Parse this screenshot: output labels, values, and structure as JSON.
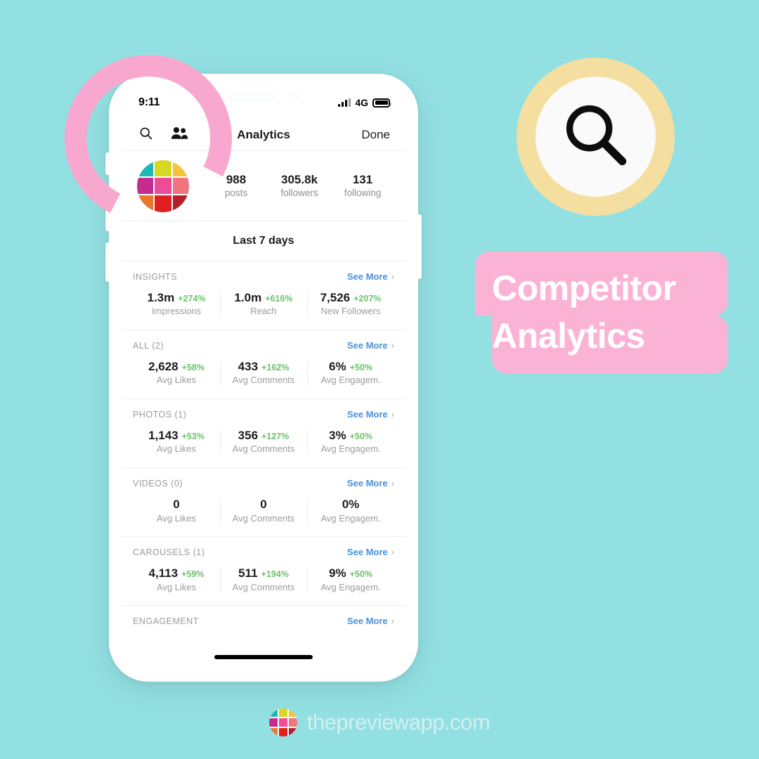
{
  "background_color": "#93e0e3",
  "status_bar": {
    "time": "9:11",
    "network": "4G",
    "signal_icon": "signal-bars-icon",
    "battery_icon": "battery-full-icon"
  },
  "nav_bar": {
    "search_icon": "search-icon",
    "people_icon": "people-icon",
    "title": "Analytics",
    "done_label": "Done"
  },
  "profile": {
    "avatar_icon": "profile-avatar-grid",
    "avatar_colors": [
      "#21b6b6",
      "#d7d824",
      "#f5c33c",
      "#c32b8e",
      "#ee4b99",
      "#f0757f",
      "#e8762b",
      "#e02020",
      "#b41f2a"
    ],
    "stats": [
      {
        "value": "988",
        "label": "posts"
      },
      {
        "value": "305.8k",
        "label": "followers"
      },
      {
        "value": "131",
        "label": "following"
      }
    ]
  },
  "period": {
    "label": "Last 7 days"
  },
  "see_more_label": "See More",
  "chevron_glyph": "›",
  "colors": {
    "link": "#4a90d9",
    "positive": "#6cc16c",
    "muted": "#9b9ba0",
    "banner_pink": "#fbb3d5",
    "ring_pink": "#f8a8cf",
    "badge_yellow": "#f5dfa0"
  },
  "sections": [
    {
      "title": "INSIGHTS",
      "metrics": [
        {
          "value": "1.3m",
          "delta": "+274%",
          "label": "Impressions"
        },
        {
          "value": "1.0m",
          "delta": "+616%",
          "label": "Reach"
        },
        {
          "value": "7,526",
          "delta": "+207%",
          "label": "New Followers"
        }
      ]
    },
    {
      "title": "ALL (2)",
      "metrics": [
        {
          "value": "2,628",
          "delta": "+58%",
          "label": "Avg Likes"
        },
        {
          "value": "433",
          "delta": "+162%",
          "label": "Avg Comments"
        },
        {
          "value": "6%",
          "delta": "+50%",
          "label": "Avg Engagem."
        }
      ]
    },
    {
      "title": "PHOTOS (1)",
      "metrics": [
        {
          "value": "1,143",
          "delta": "+53%",
          "label": "Avg Likes"
        },
        {
          "value": "356",
          "delta": "+127%",
          "label": "Avg Comments"
        },
        {
          "value": "3%",
          "delta": "+50%",
          "label": "Avg Engagem."
        }
      ]
    },
    {
      "title": "VIDEOS (0)",
      "metrics": [
        {
          "value": "0",
          "delta": "",
          "label": "Avg Likes"
        },
        {
          "value": "0",
          "delta": "",
          "label": "Avg Comments"
        },
        {
          "value": "0%",
          "delta": "",
          "label": "Avg Engagem."
        }
      ]
    },
    {
      "title": "CAROUSELS (1)",
      "metrics": [
        {
          "value": "4,113",
          "delta": "+59%",
          "label": "Avg Likes"
        },
        {
          "value": "511",
          "delta": "+194%",
          "label": "Avg Comments"
        },
        {
          "value": "9%",
          "delta": "+50%",
          "label": "Avg Engagem."
        }
      ]
    }
  ],
  "engagement_section": {
    "title": "ENGAGEMENT"
  },
  "overlay": {
    "search_badge_icon": "magnifier-icon",
    "highlight_ring_icon": "pink-highlight-circle",
    "title_line_1": "Competitor",
    "title_line_2": "Analytics"
  },
  "footer": {
    "logo_icon": "preview-app-logo",
    "text": "thepreviewapp.com"
  }
}
